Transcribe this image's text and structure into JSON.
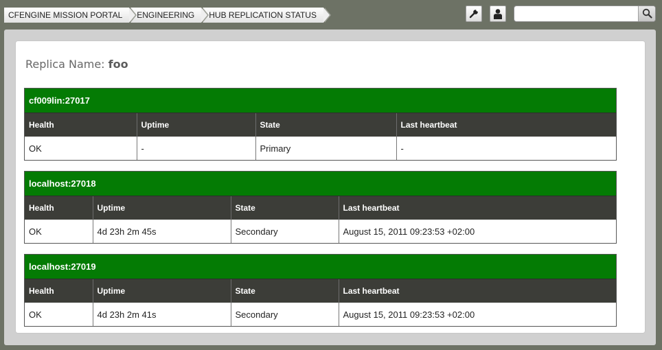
{
  "breadcrumb": [
    {
      "label": "CFENGINE MISSION PORTAL"
    },
    {
      "label": "ENGINEERING"
    },
    {
      "label": "HUB REPLICATION STATUS"
    }
  ],
  "toolbar": {
    "settings_icon": "wrench-icon",
    "user_icon": "user-icon"
  },
  "search": {
    "value": "",
    "placeholder": ""
  },
  "replica": {
    "label": "Replica Name:",
    "name": "foo"
  },
  "columns": {
    "health": "Health",
    "uptime": "Uptime",
    "state": "State",
    "heartbeat": "Last heartbeat"
  },
  "nodes": [
    {
      "host": "cf009lin:27017",
      "health": "OK",
      "uptime": "-",
      "state": "Primary",
      "heartbeat": "-"
    },
    {
      "host": "localhost:27018",
      "health": "OK",
      "uptime": "4d 23h 2m 45s",
      "state": "Secondary",
      "heartbeat": "August 15, 2011 09:23:53 +02:00"
    },
    {
      "host": "localhost:27019",
      "health": "OK",
      "uptime": "4d 23h 2m 41s",
      "state": "Secondary",
      "heartbeat": "August 15, 2011 09:23:53 +02:00"
    }
  ],
  "colors": {
    "node_header": "#047b04",
    "column_header": "#3c3d38",
    "background": "#6d7265"
  }
}
